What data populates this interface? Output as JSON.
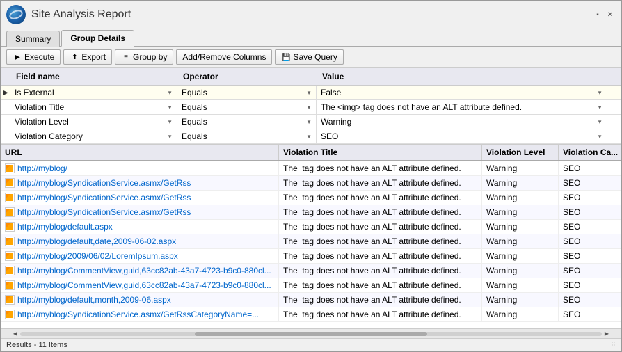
{
  "window": {
    "title": "Site Analysis Report",
    "icon_alt": "globe-icon"
  },
  "tabs": [
    {
      "id": "summary",
      "label": "Summary",
      "active": false
    },
    {
      "id": "group-details",
      "label": "Group Details",
      "active": true
    }
  ],
  "toolbar": {
    "execute_label": "Execute",
    "export_label": "Export",
    "group_by_label": "Group by",
    "add_remove_label": "Add/Remove Columns",
    "save_query_label": "Save Query"
  },
  "filter": {
    "columns": [
      "Field name",
      "Operator",
      "Value"
    ],
    "rows": [
      {
        "field": "Is External",
        "operator": "Equals",
        "value": "False"
      },
      {
        "field": "Violation Title",
        "operator": "Equals",
        "value": "The <img> tag does not have an ALT attribute defined."
      },
      {
        "field": "Violation Level",
        "operator": "Equals",
        "value": "Warning"
      },
      {
        "field": "Violation Category",
        "operator": "Equals",
        "value": "SEO"
      }
    ]
  },
  "results": {
    "columns": [
      "URL",
      "Violation Title",
      "Violation Level",
      "Violation Ca..."
    ],
    "rows": [
      {
        "url": "http://myblog/",
        "violation_title": "The <img> tag does not have an ALT attribute defined.",
        "level": "Warning",
        "category": "SEO"
      },
      {
        "url": "http://myblog/SyndicationService.asmx/GetRss",
        "violation_title": "The <img> tag does not have an ALT attribute defined.",
        "level": "Warning",
        "category": "SEO"
      },
      {
        "url": "http://myblog/SyndicationService.asmx/GetRss",
        "violation_title": "The <img> tag does not have an ALT attribute defined.",
        "level": "Warning",
        "category": "SEO"
      },
      {
        "url": "http://myblog/SyndicationService.asmx/GetRss",
        "violation_title": "The <img> tag does not have an ALT attribute defined.",
        "level": "Warning",
        "category": "SEO"
      },
      {
        "url": "http://myblog/default.aspx",
        "violation_title": "The <img> tag does not have an ALT attribute defined.",
        "level": "Warning",
        "category": "SEO"
      },
      {
        "url": "http://myblog/default,date,2009-06-02.aspx",
        "violation_title": "The <img> tag does not have an ALT attribute defined.",
        "level": "Warning",
        "category": "SEO"
      },
      {
        "url": "http://myblog/2009/06/02/LoremIpsum.aspx",
        "violation_title": "The <img> tag does not have an ALT attribute defined.",
        "level": "Warning",
        "category": "SEO"
      },
      {
        "url": "http://myblog/CommentView,guid,63cc82ab-43a7-4723-b9c0-880cl...",
        "violation_title": "The <img> tag does not have an ALT attribute defined.",
        "level": "Warning",
        "category": "SEO"
      },
      {
        "url": "http://myblog/CommentView,guid,63cc82ab-43a7-4723-b9c0-880cl...",
        "violation_title": "The <img> tag does not have an ALT attribute defined.",
        "level": "Warning",
        "category": "SEO"
      },
      {
        "url": "http://myblog/default,month,2009-06.aspx",
        "violation_title": "The <img> tag does not have an ALT attribute defined.",
        "level": "Warning",
        "category": "SEO"
      },
      {
        "url": "http://myblog/SyndicationService.asmx/GetRssCategoryName=...",
        "violation_title": "The <img> tag does not have an ALT attribute defined.",
        "level": "Warning",
        "category": "SEO"
      }
    ],
    "status": "Results - 11 Items"
  }
}
